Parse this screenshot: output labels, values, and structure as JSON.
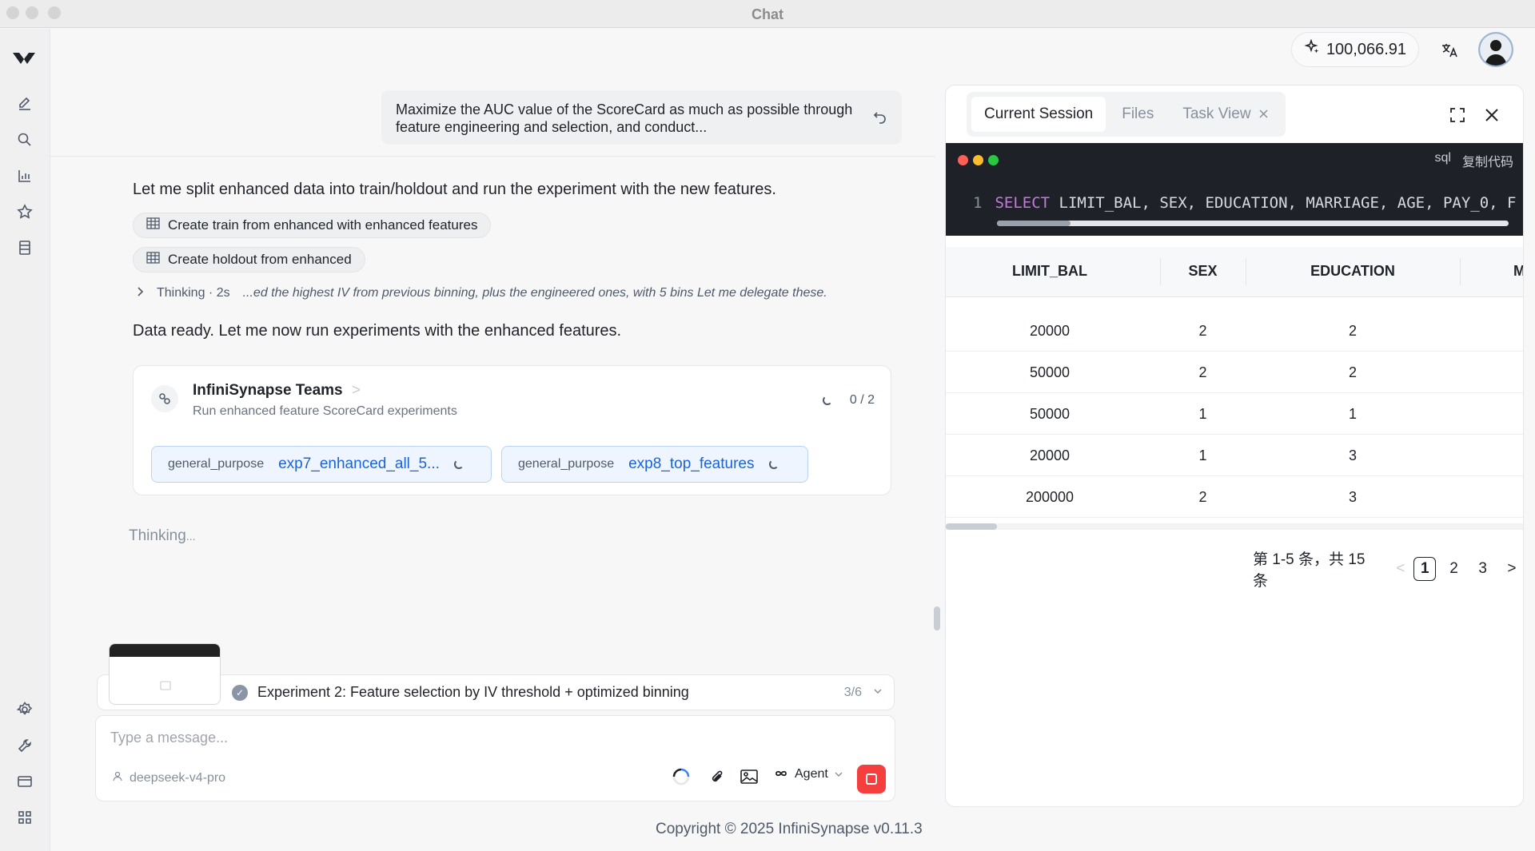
{
  "window": {
    "title": "Chat"
  },
  "header": {
    "credits": "100,066.91"
  },
  "user_message": {
    "text": "Maximize the AUC value of the ScoreCard as much as possible through feature engineering and selection, and conduct..."
  },
  "conversation": {
    "split_text": "Let me split enhanced data into train/holdout and run the experiment with the new features.",
    "chips": [
      "Create train from enhanced with enhanced features",
      "Create holdout from enhanced"
    ],
    "thinking_label": "Thinking · 2s",
    "thinking_snippet": "...ed the highest IV from previous binning, plus the engineered ones, with 5 bins Let me delegate these.",
    "ready_text": "Data ready. Let me now run experiments with the enhanced features."
  },
  "team_card": {
    "title": "InfiniSynapse Teams",
    "chevron": ">",
    "subtitle": "Run enhanced feature ScoreCard experiments",
    "count": "0 / 2",
    "tasks": [
      {
        "type": "general_purpose",
        "name": "exp7_enhanced_all_5..."
      },
      {
        "type": "general_purpose",
        "name": "exp8_top_features"
      }
    ]
  },
  "status": {
    "thinking": "Thinking",
    "dots": "..."
  },
  "progress": {
    "label": "Experiment 2: Feature selection by IV threshold + optimized binning",
    "count": "3/6"
  },
  "composer": {
    "placeholder": "Type a message...",
    "model": "deepseek-v4-pro",
    "agent_label": "Agent"
  },
  "footer": {
    "copyright": "Copyright © 2025 InfiniSynapse v0.11.3"
  },
  "panel": {
    "tabs": [
      {
        "label": "Current Session",
        "active": true
      },
      {
        "label": "Files",
        "active": false
      },
      {
        "label": "Task View",
        "active": false
      }
    ],
    "code": {
      "lang": "sql",
      "copy_label": "复制代码",
      "line_no": "1",
      "keyword": "SELECT",
      "rest": " LIMIT_BAL, SEX, EDUCATION, MARRIAGE, AGE, PAY_0, F"
    },
    "table": {
      "columns": [
        "LIMIT_BAL",
        "SEX",
        "EDUCATION",
        "M"
      ],
      "rows": [
        [
          "20000",
          "2",
          "2"
        ],
        [
          "50000",
          "2",
          "2"
        ],
        [
          "50000",
          "1",
          "1"
        ],
        [
          "20000",
          "1",
          "3"
        ],
        [
          "200000",
          "2",
          "3"
        ]
      ]
    },
    "pagination": {
      "summary": "第 1-5 条，共 15 条",
      "prev": "<",
      "pages": [
        "1",
        "2",
        "3"
      ],
      "next": ">",
      "current": "1"
    }
  },
  "colors": {
    "accent": "#1b63d8",
    "stop": "#f53f3f",
    "code_bg": "#1e2228"
  }
}
